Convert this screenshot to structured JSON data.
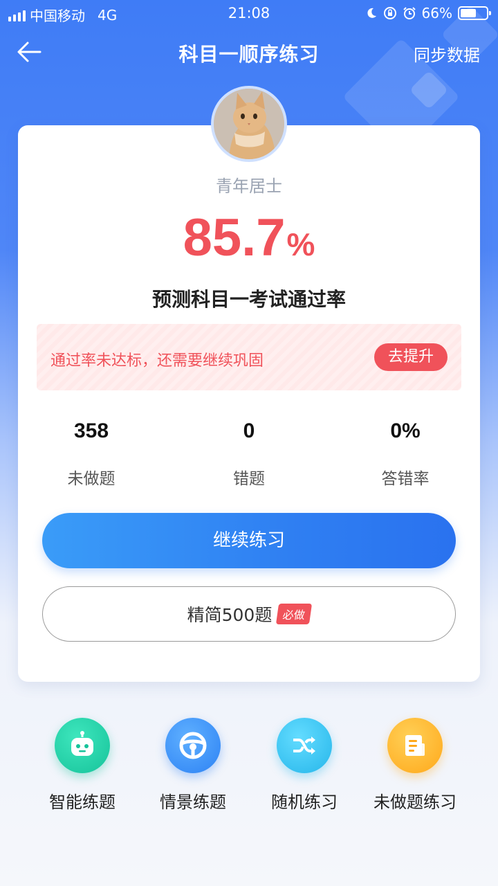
{
  "status": {
    "carrier": "中国移动",
    "network": "4G",
    "time": "21:08",
    "battery": "66%",
    "battery_level": 0.66,
    "icons": [
      "signal-icon",
      "moon-icon",
      "lock-rotation-icon",
      "alarm-icon",
      "battery-icon"
    ]
  },
  "nav": {
    "back_icon": "arrow-left-icon",
    "title": "科目一顺序练习",
    "sync": "同步数据"
  },
  "profile": {
    "username": "青年居士"
  },
  "prediction": {
    "value": "85.7",
    "unit": "%",
    "label": "预测科目一考试通过率"
  },
  "warning": {
    "text": "通过率未达标，还需要继续巩固",
    "button": "去提升"
  },
  "stats": [
    {
      "value": "358",
      "label": "未做题"
    },
    {
      "value": "0",
      "label": "错题"
    },
    {
      "value": "0%",
      "label": "答错率"
    }
  ],
  "actions": {
    "continue": "继续练习",
    "essential": "精简500题",
    "essential_badge": "必做"
  },
  "features": [
    {
      "label": "智能练题",
      "icon": "robot-icon",
      "color": "#21d0a8"
    },
    {
      "label": "情景练题",
      "icon": "steering-wheel-icon",
      "color": "#3a8cf6"
    },
    {
      "label": "随机练习",
      "icon": "shuffle-icon",
      "color": "#37c3ef"
    },
    {
      "label": "未做题练习",
      "icon": "document-icon",
      "color": "#ffb52a"
    }
  ],
  "colors": {
    "primary": "#3f7cf6",
    "danger": "#f0525a"
  }
}
